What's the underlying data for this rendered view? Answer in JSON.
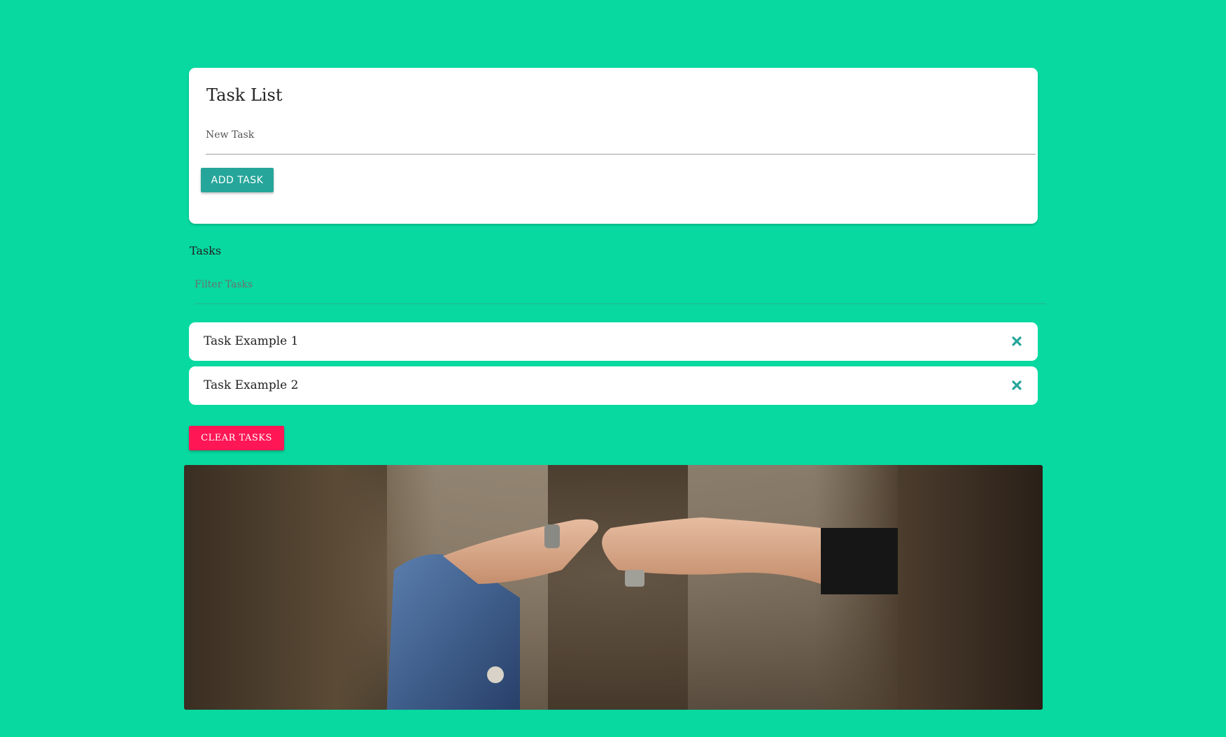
{
  "colors": {
    "background": "#07d9a0",
    "add_button": "#26a69a",
    "clear_button": "#ff1655",
    "delete_icon": "#26a69a"
  },
  "task_form": {
    "title": "Task List",
    "new_task_label": "New Task",
    "new_task_value": "",
    "add_button_label": "ADD TASK"
  },
  "tasks_section": {
    "heading": "Tasks",
    "filter_label": "Filter Tasks",
    "filter_value": "",
    "items": [
      {
        "label": "Task Example 1",
        "icon": "close-icon"
      },
      {
        "label": "Task Example 2",
        "icon": "close-icon"
      }
    ],
    "clear_button_label": "CLEAR TASKS"
  },
  "image": {
    "subject": "two hands holding"
  }
}
